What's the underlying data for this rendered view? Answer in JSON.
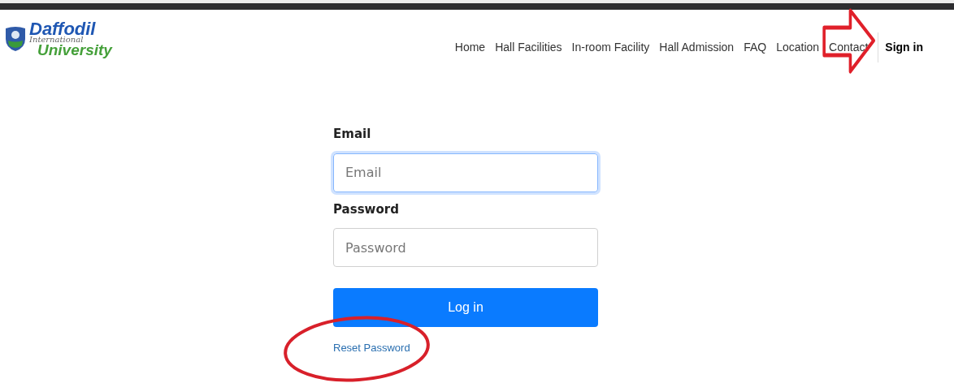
{
  "logo": {
    "line_1": "Daffodil",
    "line_2": "International",
    "line_3": "University"
  },
  "nav": [
    {
      "label": "Home",
      "selected": false
    },
    {
      "label": "Hall Facilities",
      "selected": false
    },
    {
      "label": "In-room Facility",
      "selected": false
    },
    {
      "label": "Hall Admission",
      "selected": false
    },
    {
      "label": "FAQ",
      "selected": false
    },
    {
      "label": "Location",
      "selected": false
    },
    {
      "label": "Contact",
      "selected": false
    },
    {
      "label": "Sign in",
      "selected": true
    }
  ],
  "form": {
    "fields": [
      {
        "label": "Email",
        "placeholder": "Email",
        "focused": true
      },
      {
        "label": "Password",
        "placeholder": "Password",
        "focused": false
      }
    ],
    "submit": "Log in",
    "link": "Reset Password"
  }
}
